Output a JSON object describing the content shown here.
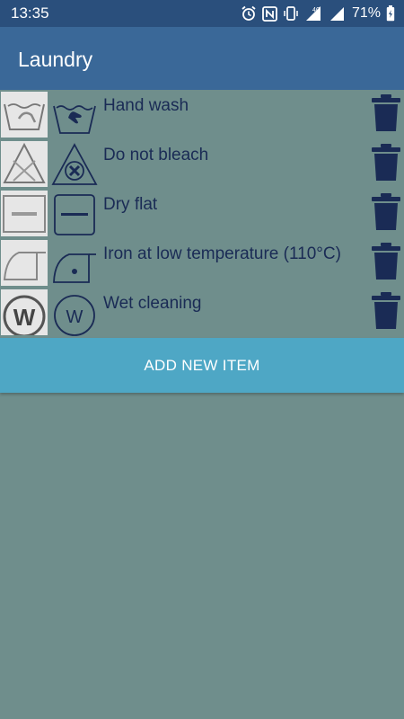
{
  "status": {
    "time": "13:35",
    "battery": "71%",
    "network": "4G"
  },
  "app": {
    "title": "Laundry"
  },
  "items": [
    {
      "label": "Hand wash",
      "symbol": "hand-wash-icon"
    },
    {
      "label": "Do not bleach",
      "symbol": "do-not-bleach-icon"
    },
    {
      "label": "Dry flat",
      "symbol": "dry-flat-icon"
    },
    {
      "label": "Iron at low temperature (110°C)",
      "symbol": "iron-low-icon"
    },
    {
      "label": "Wet cleaning",
      "symbol": "wet-cleaning-icon",
      "symbol_letter": "W"
    }
  ],
  "add_button": {
    "label": "ADD NEW ITEM"
  },
  "colors": {
    "status_bar": "#2a4f7c",
    "app_bar": "#3a6898",
    "background": "#6f8e8c",
    "accent": "#4ea7c5",
    "ink": "#1a2b55"
  }
}
